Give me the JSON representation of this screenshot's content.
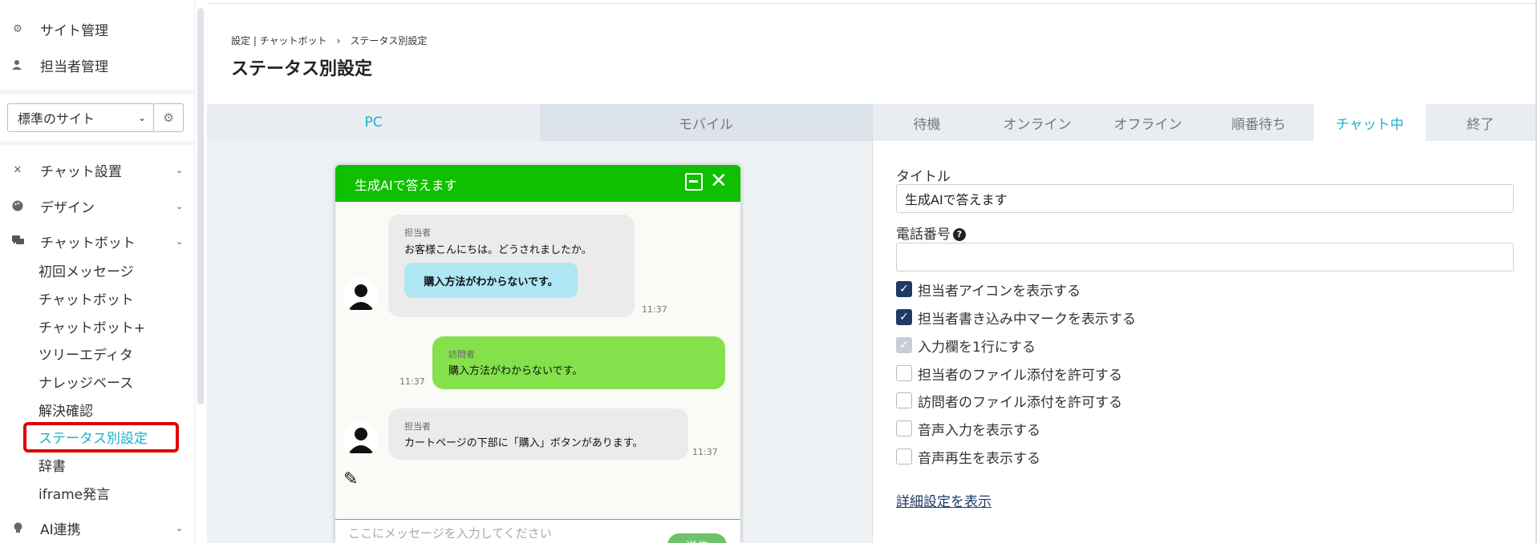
{
  "sidebar": {
    "top_items": [
      {
        "label": "サイト管理",
        "icon": "gear-icon"
      },
      {
        "label": "担当者管理",
        "icon": "person-icon"
      }
    ],
    "site_select": {
      "value": "標準のサイト"
    },
    "menu": [
      {
        "label": "チャット設置",
        "icon": "tools-icon"
      },
      {
        "label": "デザイン",
        "icon": "palette-icon"
      },
      {
        "label": "チャットボット",
        "icon": "chat-bubbles-icon"
      }
    ],
    "sub_items": [
      "初回メッセージ",
      "チャットボット",
      "チャットボット+",
      "ツリーエディタ",
      "ナレッジベース",
      "解決確認",
      "ステータス別設定",
      "辞書",
      "iframe発言"
    ],
    "bottom_item": {
      "label": "AI連携",
      "icon": "bulb-icon"
    }
  },
  "header": {
    "breadcrumb": "設定 | チャットボット　›　ステータス別設定",
    "title": "ステータス別設定"
  },
  "device_tabs": [
    "PC",
    "モバイル"
  ],
  "status_tabs": [
    "待機",
    "オンライン",
    "オフライン",
    "順番待ち",
    "チャット中",
    "終了"
  ],
  "widget": {
    "title": "生成AIで答えます",
    "messages": [
      {
        "sender": "担当者",
        "text": "お客様こんにちは。どうされましたか。",
        "quick_reply": "購入方法がわからないです。",
        "time": "11:37"
      },
      {
        "sender": "訪問者",
        "text": "購入方法がわからないです。",
        "time": "11:37"
      },
      {
        "sender": "担当者",
        "text": "カートページの下部に「購入」ボタンがあります。",
        "time": "11:37"
      }
    ],
    "input_placeholder": "ここにメッセージを入力してください",
    "send_label": "送信"
  },
  "form": {
    "title_label": "タイトル",
    "title_value": "生成AIで答えます",
    "phone_label": "電話番号",
    "phone_value": "",
    "checkboxes": [
      {
        "label": "担当者アイコンを表示する",
        "state": "checked"
      },
      {
        "label": "担当者書き込み中マークを表示する",
        "state": "checked"
      },
      {
        "label": "入力欄を1行にする",
        "state": "disabled-checked"
      },
      {
        "label": "担当者のファイル添付を許可する",
        "state": "unchecked"
      },
      {
        "label": "訪問者のファイル添付を許可する",
        "state": "unchecked"
      },
      {
        "label": "音声入力を表示する",
        "state": "unchecked"
      },
      {
        "label": "音声再生を表示する",
        "state": "unchecked"
      }
    ],
    "advanced_link": "詳細設定を表示"
  },
  "colors": {
    "accent": "#1ab0d0",
    "widget_green": "#0fc000",
    "visitor_bubble": "#84e04b",
    "highlight": "#e00000"
  }
}
